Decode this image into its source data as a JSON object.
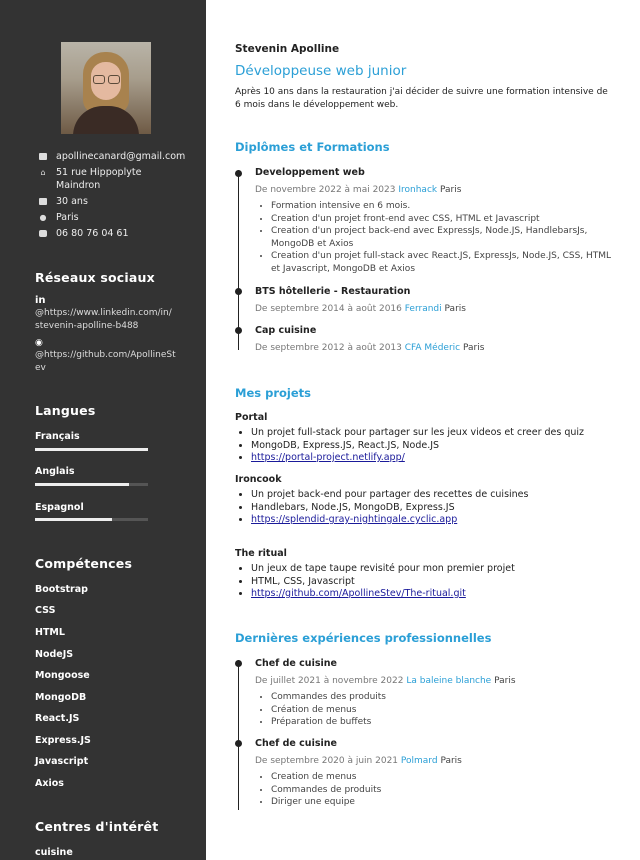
{
  "sidebar": {
    "contact": {
      "email": "apollinecanard@gmail.com",
      "address_line1": "51 rue Hippoplyte",
      "address_line2": "Maindron",
      "age": "30 ans",
      "city": "Paris",
      "phone": "06 80 76 04 61"
    },
    "social": {
      "heading": "Réseaux sociaux",
      "linkedin_logo": "in",
      "linkedin_line1": "@https://www.linkedin.com/in/",
      "linkedin_line2": "stevenin-apolline-b488",
      "github_line1": "@https://github.com/ApollineSt",
      "github_line2": "ev"
    },
    "languages": {
      "heading": "Langues",
      "items": [
        {
          "name": "Français",
          "level": 1.0
        },
        {
          "name": "Anglais",
          "level": 0.83
        },
        {
          "name": "Espagnol",
          "level": 0.68
        }
      ]
    },
    "skills": {
      "heading": "Compétences",
      "items": [
        "Bootstrap",
        "CSS",
        "HTML",
        "NodeJS",
        "Mongoose",
        "MongoDB",
        "React.JS",
        "Express.JS",
        "Javascript",
        "Axios"
      ]
    },
    "interests": {
      "heading": "Centres d'intérêt",
      "items": [
        "cuisine"
      ]
    }
  },
  "header": {
    "name": "Stevenin Apolline",
    "title": "Développeuse web junior",
    "intro": "Après 10 ans dans la restauration j'ai décider de suivre une formation intensive de 6 mois dans le développement web."
  },
  "education": {
    "heading": "Diplômes et Formations",
    "items": [
      {
        "title": "Developpement web",
        "dates": "De novembre 2022 à mai 2023",
        "org": "Ironhack",
        "city": "Paris",
        "bullets": [
          "Formation intensive en 6 mois.",
          "Creation d'un projet front-end avec CSS, HTML et Javascript",
          "Creation d'un project back-end avec ExpressJs, Node.JS, HandlebarsJs, MongoDB et Axios",
          "Creation d'un projet full-stack avec React.JS, ExpressJs, Node.JS, CSS, HTML et Javascript, MongoDB et Axios"
        ]
      },
      {
        "title": "BTS hôtellerie - Restauration",
        "dates": "De septembre 2014 à août 2016",
        "org": "Ferrandi",
        "city": "Paris"
      },
      {
        "title": "Cap cuisine",
        "dates": "De septembre 2012 à août 2013",
        "org": "CFA Méderic",
        "city": "Paris"
      }
    ]
  },
  "projects": {
    "heading": "Mes projets",
    "items": [
      {
        "name": "Portal",
        "bullets": [
          "Un projet full-stack pour partager sur les jeux videos et creer des quiz",
          "MongoDB, Express.JS, React.JS, Node.JS"
        ],
        "link": "https://portal-project.netlify.app/"
      },
      {
        "name": "Ironcook",
        "bullets": [
          "Un projet back-end pour partager des recettes de cuisines",
          "Handlebars, Node.JS, MongoDB, Express.JS"
        ],
        "link": "https://splendid-gray-nightingale.cyclic.app"
      },
      {
        "name": "The ritual",
        "bullets": [
          "Un jeux de tape taupe revisité pour mon premier projet",
          "HTML, CSS, Javascript"
        ],
        "link": "https://github.com/ApollineStev/The-ritual.git"
      }
    ]
  },
  "experience": {
    "heading": "Dernières expériences professionnelles",
    "items": [
      {
        "title": "Chef de cuisine",
        "dates": "De juillet 2021 à novembre 2022",
        "org": "La baleine blanche",
        "city": "Paris",
        "bullets": [
          "Commandes des produits",
          "Création de menus",
          "Préparation de buffets"
        ]
      },
      {
        "title": "Chef de cuisine",
        "dates": "De septembre 2020 à juin 2021",
        "org": "Polmard",
        "city": "Paris",
        "bullets": [
          "Creation de menus",
          "Commandes de produits",
          "Diriger une equipe"
        ]
      }
    ]
  },
  "colors": {
    "sidebar_bg": "#333333",
    "accent": "#2b9fd6"
  }
}
